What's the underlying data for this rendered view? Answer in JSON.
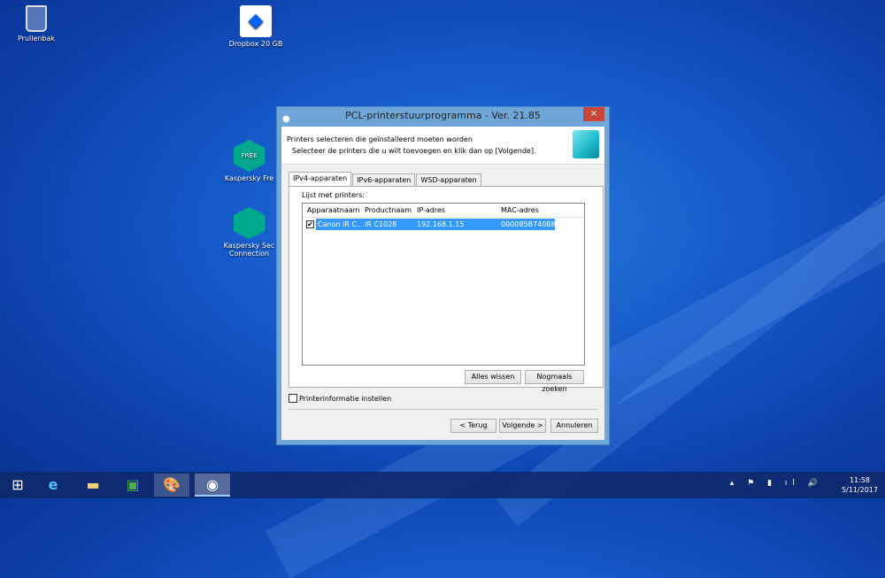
{
  "desktop": {
    "icons": [
      {
        "label": "Prullenbak"
      },
      {
        "label": "Dropbox 20 GB"
      },
      {
        "label": "Kaspersky Fre"
      },
      {
        "label": "Kaspersky Sec Connection"
      }
    ]
  },
  "dialog": {
    "title": "PCL-printerstuurprogramma - Ver. 21.85",
    "close": "×",
    "heading": "Printers selecteren die geïnstalleerd moeten worden",
    "subheading": "Selecteer de printers die u wilt toevoegen en klik dan op [Volgende].",
    "tabs": [
      "IPv4-apparaten",
      "IPv6-apparaten",
      "WSD-apparaten"
    ],
    "list_label": "Lijst met printers:",
    "columns": [
      "Apparaatnaam",
      "Productnaam",
      "IP-adres",
      "MAC-adres"
    ],
    "rows": [
      {
        "checked": true,
        "device": "Canon iR C...",
        "product": "iR C1028",
        "ip": "192.168.1.15",
        "mac": "000085B740BB"
      }
    ],
    "clear_all": "Alles wissen",
    "search_again": "Nogmaals zoeken",
    "printer_info_checkbox": "Printerinformatie instellen",
    "back": "< Terug",
    "next": "Volgende >",
    "cancel": "Annuleren"
  },
  "taskbar": {
    "time": "11:58",
    "date": "5/11/2017"
  }
}
